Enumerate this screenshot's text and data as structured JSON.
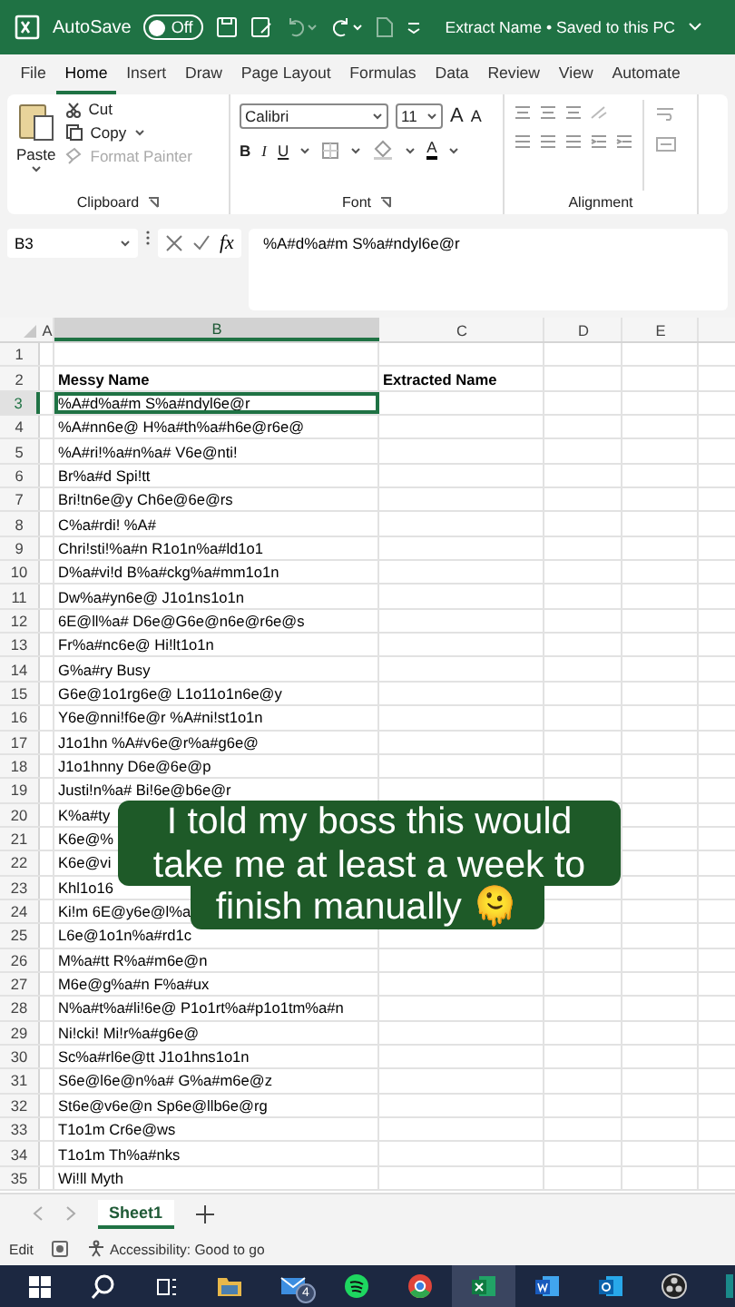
{
  "title_bar": {
    "autosave_label": "AutoSave",
    "autosave_on": false,
    "autosave_state": "Off",
    "document_title": "Extract Name • Saved to this PC"
  },
  "ribbon_tabs": [
    {
      "label": "File",
      "selected": false
    },
    {
      "label": "Home",
      "selected": true
    },
    {
      "label": "Insert",
      "selected": false
    },
    {
      "label": "Draw",
      "selected": false
    },
    {
      "label": "Page Layout",
      "selected": false
    },
    {
      "label": "Formulas",
      "selected": false
    },
    {
      "label": "Data",
      "selected": false
    },
    {
      "label": "Review",
      "selected": false
    },
    {
      "label": "View",
      "selected": false
    },
    {
      "label": "Automate",
      "selected": false
    }
  ],
  "ribbon": {
    "clipboard": {
      "paste": "Paste",
      "cut": "Cut",
      "copy": "Copy",
      "format_painter": "Format Painter",
      "group": "Clipboard"
    },
    "font": {
      "name": "Calibri",
      "size": "11",
      "grow": "A",
      "shrink": "A",
      "bold": "B",
      "italic": "I",
      "underline": "U",
      "color_letter": "A",
      "group": "Font"
    },
    "alignment": {
      "group": "Alignment"
    }
  },
  "formula_bar": {
    "name_box": "B3",
    "fx": "fx",
    "content": "%A#d%a#m S%a#ndyl6e@r"
  },
  "sheet": {
    "columns": [
      {
        "label": "A",
        "selected": false
      },
      {
        "label": "B",
        "selected": true
      },
      {
        "label": "C",
        "selected": false
      },
      {
        "label": "D",
        "selected": false
      },
      {
        "label": "E",
        "selected": false
      }
    ],
    "rows": [
      {
        "number": "1",
        "selected": false
      },
      {
        "number": "2",
        "selected": false,
        "kind": "header",
        "b": "Messy Name",
        "c": "Extracted Name"
      },
      {
        "number": "3",
        "selected": true,
        "b": "%A#d%a#m S%a#ndyl6e@r"
      },
      {
        "number": "4",
        "selected": false,
        "b": "%A#nn6e@ H%a#th%a#h6e@r6e@"
      },
      {
        "number": "5",
        "selected": false,
        "b": "%A#ri!%a#n%a# V6e@nti!"
      },
      {
        "number": "6",
        "selected": false,
        "b": "Br%a#d Spi!tt"
      },
      {
        "number": "7",
        "selected": false,
        "b": "Bri!tn6e@y Ch6e@6e@rs"
      },
      {
        "number": "8",
        "selected": false,
        "b": "C%a#rdi! %A#"
      },
      {
        "number": "9",
        "selected": false,
        "b": "Chri!sti!%a#n R1o1n%a#ld1o1"
      },
      {
        "number": "10",
        "selected": false,
        "b": "D%a#vi!d B%a#ckg%a#mm1o1n"
      },
      {
        "number": "11",
        "selected": false,
        "b": "Dw%a#yn6e@ J1o1ns1o1n"
      },
      {
        "number": "12",
        "selected": false,
        "b": "6E@ll%a# D6e@G6e@n6e@r6e@s"
      },
      {
        "number": "13",
        "selected": false,
        "b": "Fr%a#nc6e@ Hi!lt1o1n"
      },
      {
        "number": "14",
        "selected": false,
        "b": "G%a#ry Busy"
      },
      {
        "number": "15",
        "selected": false,
        "b": "G6e@1o1rg6e@ L1o11o1n6e@y"
      },
      {
        "number": "16",
        "selected": false,
        "b": "Y6e@nni!f6e@r %A#ni!st1o1n"
      },
      {
        "number": "17",
        "selected": false,
        "b": "J1o1hn %A#v6e@r%a#g6e@"
      },
      {
        "number": "18",
        "selected": false,
        "b": "J1o1hnny D6e@6e@p"
      },
      {
        "number": "19",
        "selected": false,
        "b": "Justi!n%a# Bi!6e@b6e@r"
      },
      {
        "number": "20",
        "selected": false,
        "b": "K%a#ty"
      },
      {
        "number": "21",
        "selected": false,
        "b": "K6e@%"
      },
      {
        "number": "22",
        "selected": false,
        "b": "K6e@vi"
      },
      {
        "number": "23",
        "selected": false,
        "b": "Khl1o16"
      },
      {
        "number": "24",
        "selected": false,
        "b": "Ki!m 6E@y6e@l%a"
      },
      {
        "number": "25",
        "selected": false,
        "b": "L6e@1o1n%a#rd1c"
      },
      {
        "number": "26",
        "selected": false,
        "b": "M%a#tt R%a#m6e@n"
      },
      {
        "number": "27",
        "selected": false,
        "b": "M6e@g%a#n F%a#ux"
      },
      {
        "number": "28",
        "selected": false,
        "b": "N%a#t%a#li!6e@ P1o1rt%a#p1o1tm%a#n"
      },
      {
        "number": "29",
        "selected": false,
        "b": "Ni!cki! Mi!r%a#g6e@"
      },
      {
        "number": "30",
        "selected": false,
        "b": "Sc%a#rl6e@tt J1o1hns1o1n"
      },
      {
        "number": "31",
        "selected": false,
        "b": "S6e@l6e@n%a# G%a#m6e@z"
      },
      {
        "number": "32",
        "selected": false,
        "b": "St6e@v6e@n Sp6e@llb6e@rg"
      },
      {
        "number": "33",
        "selected": false,
        "b": "T1o1m Cr6e@ws"
      },
      {
        "number": "34",
        "selected": false,
        "b": "T1o1m Th%a#nks"
      },
      {
        "number": "35",
        "selected": false,
        "b": "Wi!ll Myth"
      }
    ]
  },
  "caption": {
    "lines": [
      "I told my boss this would",
      "take me at least a week to",
      "finish manually 🫠"
    ]
  },
  "sheet_tabs": [
    {
      "label": "Sheet1",
      "selected": true
    }
  ],
  "status_bar": {
    "mode": "Edit",
    "accessibility": "Accessibility: Good to go"
  },
  "taskbar": {
    "mail_badge": "4",
    "apps": [
      {
        "kind": "folder",
        "active": false
      },
      {
        "kind": "mail",
        "active": false
      },
      {
        "kind": "music",
        "active": false
      },
      {
        "kind": "browser",
        "active": false
      },
      {
        "kind": "sheet",
        "active": true
      },
      {
        "kind": "doc",
        "active": false
      },
      {
        "kind": "outlook",
        "active": false
      },
      {
        "kind": "recorder",
        "active": false
      },
      {
        "kind": "panel",
        "active": false
      }
    ]
  }
}
